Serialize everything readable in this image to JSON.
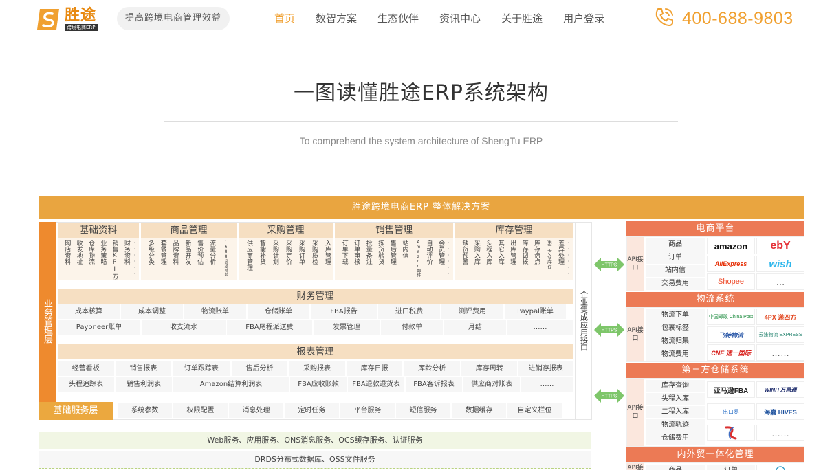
{
  "header": {
    "logo_name": "胜途",
    "logo_sub": "跨境电商ERP",
    "slogan": "提高跨境电商管理效益",
    "nav": [
      "首页",
      "数智方案",
      "生态伙伴",
      "资讯中心",
      "关于胜途",
      "用户登录"
    ],
    "phone": "400-688-9803"
  },
  "title": "一图读懂胜途ERP系统架构",
  "subtitle": "To comprehend the system architecture of ShengTu ERP",
  "diagram": {
    "top_bar": "胜途跨境电商ERP 整体解决方案",
    "biz_layer": "业务管理层",
    "enterprise": "企业集成应用接口",
    "modules": [
      {
        "title": "基础资料",
        "items": [
          "网店资料",
          "收发地址",
          "仓库物流",
          "业务策略",
          "销售KPI方案",
          "财务资料"
        ]
      },
      {
        "title": "商品管理",
        "items": [
          "多级分类",
          "套餐管理",
          "品牌资料",
          "新品开发",
          "售价预估",
          "流量分析",
          "1688货源商品"
        ]
      },
      {
        "title": "采购管理",
        "items": [
          "供应商管理",
          "智能补货",
          "采购计划",
          "采购定价",
          "采购订单",
          "采购质检",
          "入库管理"
        ]
      },
      {
        "title": "销售管理",
        "items": [
          "订单下载",
          "订单审核",
          "批量备注",
          "拣货验货",
          "售后管理",
          "站内信",
          "Amazon邮件",
          "自动评价",
          "会员管理"
        ]
      },
      {
        "title": "库存管理",
        "items": [
          "缺货预警",
          "采购入库",
          "头程入库",
          "其它入库",
          "出库管理",
          "库存调拨",
          "库存盘点",
          "第三方仓库存",
          "差异处理"
        ]
      }
    ],
    "finance": {
      "title": "财务管理",
      "row1": [
        "成本核算",
        "成本调整",
        "物流账单",
        "仓储账单",
        "FBA报告",
        "进口税费",
        "测评费用",
        "Paypal账单"
      ],
      "row2": [
        "Payoneer账单",
        "收支流水",
        "FBA尾程派送费",
        "发票管理",
        "付款单",
        "月结",
        "……"
      ]
    },
    "report": {
      "title": "报表管理",
      "row1": [
        "经营看板",
        "销售报表",
        "订单跟踪表",
        "售后分析",
        "采购报表",
        "库存日报",
        "库龄分析",
        "库存周转",
        "进销存报表"
      ],
      "row2": [
        "头程追踪表",
        "销售利润表",
        "Amazon结算利润表",
        "FBA应收账款",
        "FBA退款退货表",
        "FBA客诉报表",
        "供应商对账表",
        "……"
      ]
    },
    "base_layer": {
      "label": "基础服务层",
      "items": [
        "系统参数",
        "权限配置",
        "消息处理",
        "定时任务",
        "平台服务",
        "短信服务",
        "数据缓存",
        "自定义栏位"
      ]
    },
    "infra": [
      "Web服务、应用服务、ONS消息服务、OCS缓存服务、认证服务",
      "DRDS分布式数据库、OSS文件服务"
    ],
    "https_label": "HTTPS",
    "api_label": "API接口"
  },
  "platforms": [
    {
      "title": "电商平台",
      "items": [
        "商品",
        "订单",
        "站内信",
        "交易费用"
      ],
      "logos": [
        "amazon",
        "ebY",
        "AliExpress",
        "wish",
        "Shopee",
        "…"
      ]
    },
    {
      "title": "物流系统",
      "items": [
        "物流下单",
        "包裹标签",
        "物流归集",
        "物流费用"
      ],
      "logos": [
        "中国邮政 China Post",
        "4PX 递四方",
        "飞特物流",
        "云途物流 EXPRESS",
        "CNE 递一国际",
        "……"
      ]
    },
    {
      "title": "第三方仓储系统",
      "items": [
        "库存查询",
        "头程入库",
        "二程入库",
        "物流轨迹",
        "仓储费用"
      ],
      "logos": [
        "亚马逊FBA",
        "WINIT万邑通",
        "出口易",
        "海嘉 HIVES",
        "",
        "……"
      ]
    },
    {
      "title": "内外贸一体化管理",
      "items": [
        "商品",
        "订单"
      ]
    }
  ],
  "colors": {
    "accent": "#f0a030",
    "top_bar": "#e9a540",
    "biz_layer": "#ee8a2e",
    "platform_head": "#ec7a55"
  }
}
